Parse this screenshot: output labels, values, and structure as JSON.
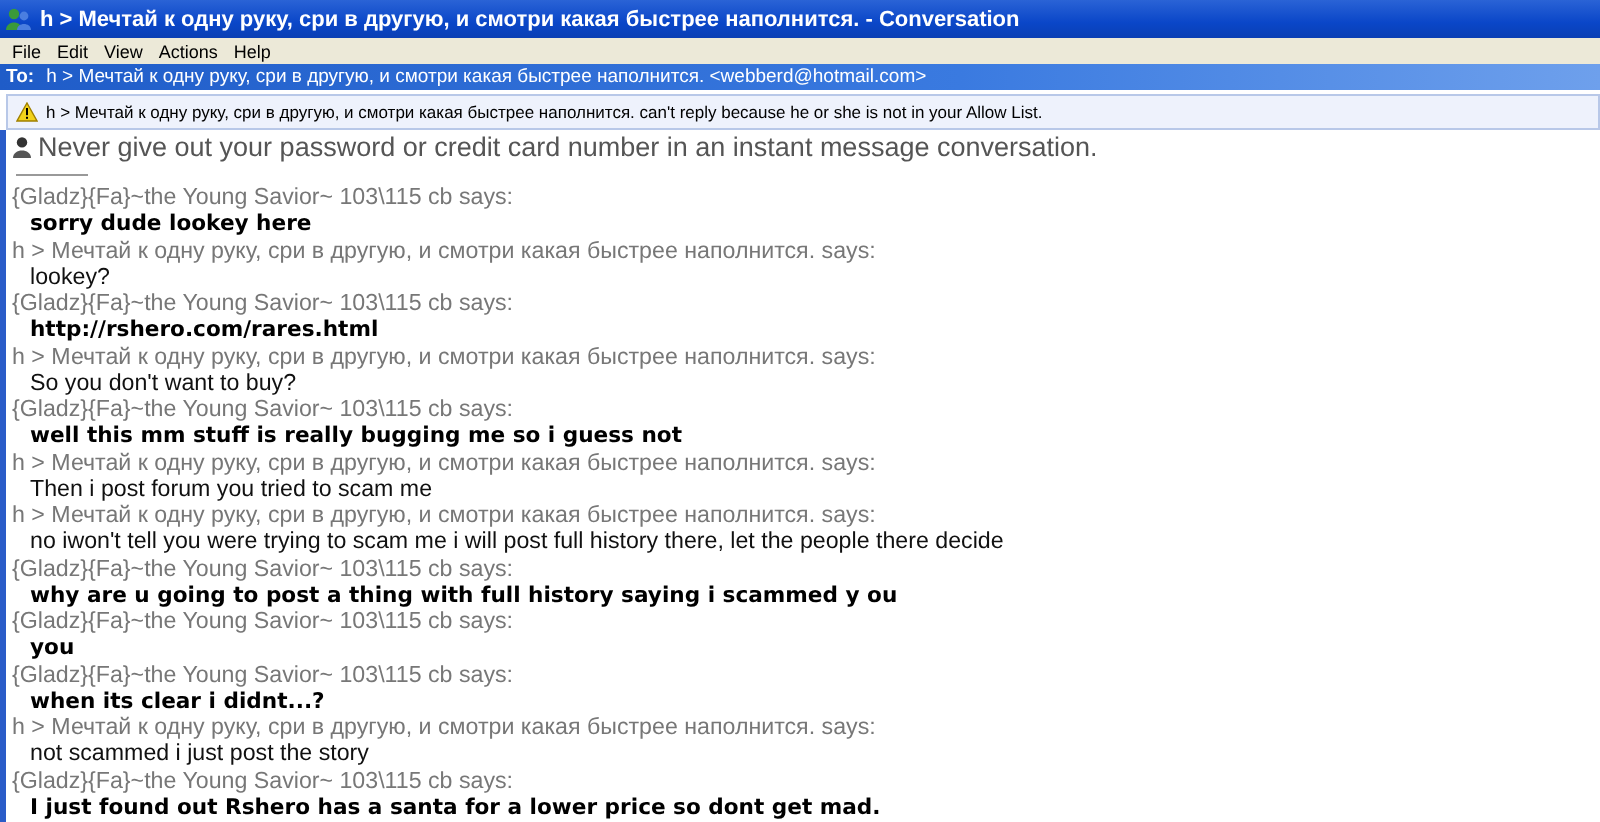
{
  "window": {
    "title": "h > Мечтай к одну руку, сри в другую, и смотри какая быстрее наполнится. - Conversation"
  },
  "menu": [
    "File",
    "Edit",
    "View",
    "Actions",
    "Help"
  ],
  "to": {
    "label": "To:",
    "recipient": "h > Мечтай к одну руку, сри в другую, и смотри какая быстрее наполнится. <webberd@hotmail.com>"
  },
  "warning": "h > Мечтай к одну руку, сри в другую, и смотри какая быстрее наполнится. can't reply because he or she is not in your Allow List.",
  "notice": "Never give out your password or credit card number in an instant message conversation.",
  "messages": [
    {
      "sender": "{Gladz}{Fa}~the Young Savior~ 103\\115 cb says:",
      "text": "sorry dude lookey here",
      "bold": true
    },
    {
      "sender": "h > Мечтай к одну руку, сри в другую, и смотри какая быстрее наполнится. says:",
      "text": "lookey?",
      "bold": false
    },
    {
      "sender": "{Gladz}{Fa}~the Young Savior~ 103\\115 cb says:",
      "text": "http://rshero.com/rares.html",
      "bold": true
    },
    {
      "sender": "h > Мечтай к одну руку, сри в другую, и смотри какая быстрее наполнится. says:",
      "text": "So you don't want to buy?",
      "bold": false
    },
    {
      "sender": "{Gladz}{Fa}~the Young Savior~ 103\\115 cb says:",
      "text": "well this mm stuff is really bugging me so  i guess not",
      "bold": true
    },
    {
      "sender": "h > Мечтай к одну руку, сри в другую, и смотри какая быстрее наполнится. says:",
      "text": "Then i post forum you tried to scam me",
      "bold": false
    },
    {
      "sender": "h > Мечтай к одну руку, сри в другую, и смотри какая быстрее наполнится. says:",
      "text": "no iwon't tell you were trying to scam me i will post full history there, let the people there decide",
      "bold": false
    },
    {
      "sender": "{Gladz}{Fa}~the Young Savior~ 103\\115 cb says:",
      "text": "why are u going to post a thing with full history saying i scammed y ou",
      "bold": true
    },
    {
      "sender": "{Gladz}{Fa}~the Young Savior~ 103\\115 cb says:",
      "text": "you",
      "bold": true
    },
    {
      "sender": "{Gladz}{Fa}~the Young Savior~ 103\\115 cb says:",
      "text": "when its clear i didnt...?",
      "bold": true
    },
    {
      "sender": "h > Мечтай к одну руку, сри в другую, и смотри какая быстрее наполнится. says:",
      "text": "not scammed i just post the story",
      "bold": false
    },
    {
      "sender": "{Gladz}{Fa}~the Young Savior~ 103\\115 cb says:",
      "text": "I just found out Rshero has a santa for a lower price so dont get mad.",
      "bold": true
    }
  ]
}
